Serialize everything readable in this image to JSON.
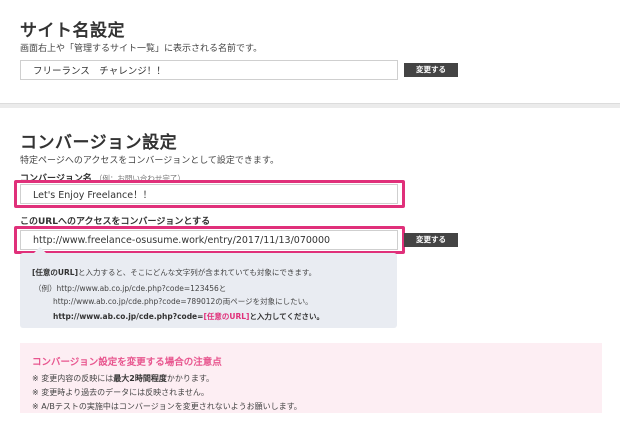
{
  "site_settings": {
    "title": "サイト名設定",
    "description": "画面右上や「管理するサイト一覧」に表示される名前です。",
    "site_name_value": "フリーランス　チャレンジ！！",
    "change_button": "変更する"
  },
  "conversion_settings": {
    "title": "コンバージョン設定",
    "description": "特定ページへのアクセスをコンバージョンとして設定できます。",
    "name_label": "コンバージョン名",
    "name_hint": "（例：お問い合わせ完了）",
    "name_value": "Let's Enjoy Freelance！！",
    "url_label": "このURLへのアクセスをコンバージョンとする",
    "url_value": "http://www.freelance-osusume.work/entry/2017/11/13/070000",
    "change_button": "変更する",
    "highlight_color": "#e0307a"
  },
  "help": {
    "line1_bold": "[任意のURL]",
    "line1_rest": "と入力すると、そこにどんな文字列が含まれていても対象にできます。",
    "line2": "（例）http://www.ab.co.jp/cde.php?code=123456と",
    "line3": "http://www.ab.co.jp/cde.php?code=789012の両ページを対象にしたい。",
    "line4_prefix": "http://www.ab.co.jp/cde.php?code=",
    "line4_pink": "[任意のURL]",
    "line4_suffix": "と入力してください。"
  },
  "notice": {
    "title": "コンバージョン設定を変更する場合の注意点",
    "line1_prefix": "※ 変更内容の反映には",
    "line1_bold": "最大2時間程度",
    "line1_suffix": "かかります。",
    "line2": "※ 変更時より過去のデータには反映されません。",
    "line3": "※ A/Bテストの実施中はコンバージョンを変更されないようお願いします。",
    "title_color": "#e8568f"
  }
}
